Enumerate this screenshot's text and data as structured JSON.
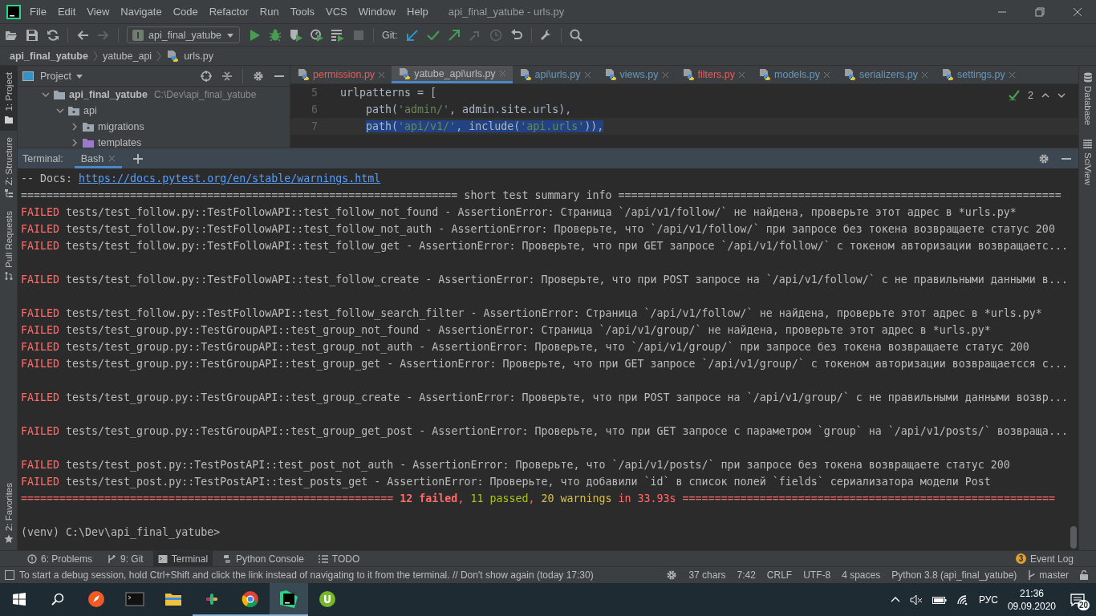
{
  "window": {
    "title": "api_final_yatube - urls.py"
  },
  "menu": [
    "File",
    "Edit",
    "View",
    "Navigate",
    "Code",
    "Refactor",
    "Run",
    "Tools",
    "VCS",
    "Window",
    "Help"
  ],
  "toolbar": {
    "run_config": "api_final_yatube",
    "git_label": "Git:"
  },
  "breadcrumb": [
    "api_final_yatube",
    "yatube_api",
    "urls.py"
  ],
  "left_tool_tabs": [
    {
      "label": "1: Project",
      "kind": "project",
      "selected": true
    },
    {
      "label": "Z: Structure",
      "kind": "structure",
      "selected": false
    },
    {
      "label": "Pull Requests",
      "kind": "pull_requests",
      "selected": false
    }
  ],
  "left_bottom_tabs": [
    {
      "label": "2: Favorites",
      "kind": "favorites",
      "selected": false
    }
  ],
  "right_tool_tabs": [
    {
      "label": "Database",
      "kind": "database"
    },
    {
      "label": "SciView",
      "kind": "sciview"
    }
  ],
  "project": {
    "title": "Project",
    "tree": [
      {
        "name": "api_final_yatube",
        "path": "C:\\Dev\\api_final_yatube",
        "kind": "root",
        "expanded": true,
        "children": [
          {
            "name": "api",
            "kind": "package",
            "expanded": true,
            "children": [
              {
                "name": "migrations",
                "kind": "package",
                "expanded": false
              },
              {
                "name": "templates",
                "kind": "templates",
                "expanded": false
              }
            ]
          }
        ]
      }
    ]
  },
  "editor_tabs": [
    {
      "label": "permission.py",
      "kind": "error",
      "selected": false
    },
    {
      "label": "yatube_api\\urls.py",
      "kind": "plain",
      "selected": true
    },
    {
      "label": "api\\urls.py",
      "kind": "modified",
      "selected": false
    },
    {
      "label": "views.py",
      "kind": "modified",
      "selected": false
    },
    {
      "label": "filters.py",
      "kind": "error",
      "selected": false
    },
    {
      "label": "models.py",
      "kind": "modified",
      "selected": false
    },
    {
      "label": "serializers.py",
      "kind": "modified",
      "selected": false
    },
    {
      "label": "settings.py",
      "kind": "modified",
      "selected": false
    }
  ],
  "editor": {
    "inspection_count": "2",
    "lines": [
      {
        "number": "5",
        "selected": false,
        "tokens": [
          {
            "text": "urlpatterns = [",
            "kind": "plain"
          }
        ]
      },
      {
        "number": "6",
        "selected": false,
        "tokens": [
          {
            "text": "    path(",
            "kind": "plain"
          },
          {
            "text": "'admin/'",
            "kind": "string"
          },
          {
            "text": ", admin.site.urls),",
            "kind": "plain"
          }
        ]
      },
      {
        "number": "7",
        "selected": true,
        "tokens": [
          {
            "text": "    path(",
            "kind": "plain"
          },
          {
            "text": "'api/v1/'",
            "kind": "string"
          },
          {
            "text": ", include(",
            "kind": "plain"
          },
          {
            "text": "'api.urls'",
            "kind": "string"
          },
          {
            "text": ")),",
            "kind": "plain"
          }
        ]
      }
    ]
  },
  "terminal": {
    "label": "Terminal:",
    "tabs": [
      {
        "label": "Bash",
        "selected": true
      }
    ],
    "lines": [
      {
        "kind": "docs",
        "prefix": "-- Docs: ",
        "link": "https://docs.pytest.org/en/stable/warnings.html"
      },
      {
        "kind": "rule",
        "text": "==================================================================== short test summary info ====================================================================="
      },
      {
        "kind": "failed",
        "status": "FAILED",
        "text": " tests/test_follow.py::TestFollowAPI::test_follow_not_found - AssertionError: Страница `/api/v1/follow/` не найдена, проверьте этот адрес в *urls.py*",
        "gap_after": false
      },
      {
        "kind": "failed",
        "status": "FAILED",
        "text": " tests/test_follow.py::TestFollowAPI::test_follow_not_auth - AssertionError: Проверьте, что `/api/v1/follow/` при запросе без токена возвращаете статус 200",
        "gap_after": false
      },
      {
        "kind": "failed",
        "status": "FAILED",
        "text": " tests/test_follow.py::TestFollowAPI::test_follow_get - AssertionError: Проверьте, что при GET запросе `/api/v1/follow/` с токеном авторизации возвращаетс...",
        "gap_after": true
      },
      {
        "kind": "failed",
        "status": "FAILED",
        "text": " tests/test_follow.py::TestFollowAPI::test_follow_create - AssertionError: Проверьте, что при POST запросе на `/api/v1/follow/` с не правильными данными в...",
        "gap_after": true
      },
      {
        "kind": "failed",
        "status": "FAILED",
        "text": " tests/test_follow.py::TestFollowAPI::test_follow_search_filter - AssertionError: Страница `/api/v1/follow/` не найдена, проверьте этот адрес в *urls.py*",
        "gap_after": false
      },
      {
        "kind": "failed",
        "status": "FAILED",
        "text": " tests/test_group.py::TestGroupAPI::test_group_not_found - AssertionError: Страница `/api/v1/group/` не найдена, проверьте этот адрес в *urls.py*",
        "gap_after": false
      },
      {
        "kind": "failed",
        "status": "FAILED",
        "text": " tests/test_group.py::TestGroupAPI::test_group_not_auth - AssertionError: Проверьте, что `/api/v1/group/` при запросе без токена возвращаете статус 200",
        "gap_after": false
      },
      {
        "kind": "failed",
        "status": "FAILED",
        "text": " tests/test_group.py::TestGroupAPI::test_group_get - AssertionError: Проверьте, что при GET запросе `/api/v1/group/` с токеном авторизации возвращаетсся с...",
        "gap_after": true
      },
      {
        "kind": "failed",
        "status": "FAILED",
        "text": " tests/test_group.py::TestGroupAPI::test_group_create - AssertionError: Проверьте, что при POST запросе на `/api/v1/group/` с не правильными данными возвр...",
        "gap_after": true
      },
      {
        "kind": "failed",
        "status": "FAILED",
        "text": " tests/test_group.py::TestGroupAPI::test_group_get_post - AssertionError: Проверьте, что при GET запросе с параметром `group` на `/api/v1/posts/` возвраща...",
        "gap_after": true
      },
      {
        "kind": "failed",
        "status": "FAILED",
        "text": " tests/test_post.py::TestPostAPI::test_post_not_auth - AssertionError: Проверьте, что `/api/v1/posts/` при запросе без токена возвращаете статус 200",
        "gap_after": false
      },
      {
        "kind": "failed",
        "status": "FAILED",
        "text": " tests/test_post.py::TestPostAPI::test_posts_get - AssertionError: Проверьте, что добавили `id` в список полей `fields` сериализатора модели Post",
        "gap_after": false
      },
      {
        "kind": "summary",
        "gap_after": true,
        "parts": [
          {
            "text": "========================================================== ",
            "kind": "plain"
          },
          {
            "text": "12 failed",
            "kind": "failed"
          },
          {
            "text": ", ",
            "kind": "plain"
          },
          {
            "text": "11 passed",
            "kind": "passed"
          },
          {
            "text": ", ",
            "kind": "plain"
          },
          {
            "text": "20 warnings",
            "kind": "warnings"
          },
          {
            "text": " in 33.93s ==========================================================",
            "kind": "plain"
          }
        ]
      },
      {
        "kind": "prompt",
        "text": "(venv) C:\\Dev\\api_final_yatube>"
      }
    ]
  },
  "tool_windows": [
    {
      "label": "6: Problems",
      "kind": "problems",
      "selected": false
    },
    {
      "label": "9: Git",
      "kind": "git",
      "selected": false
    },
    {
      "label": "Terminal",
      "kind": "terminal",
      "selected": true
    },
    {
      "label": "Python Console",
      "kind": "python",
      "selected": false
    },
    {
      "label": "TODO",
      "kind": "todo",
      "selected": false
    }
  ],
  "event_log": {
    "label": "Event Log",
    "count": "3"
  },
  "status_bar": {
    "message": "To start a debug session, hold Ctrl+Shift and click the link instead of navigating to it from the terminal. // Don't show again (today 17:30)",
    "items": [
      "37 chars",
      "7:42",
      "CRLF",
      "UTF-8",
      "4 spaces",
      "Python 3.8 (api_final_yatube)"
    ],
    "branch": "master"
  },
  "taskbar": {
    "apps": [
      {
        "kind": "rocket",
        "running": false,
        "selected": false
      },
      {
        "kind": "console",
        "running": false,
        "selected": false
      },
      {
        "kind": "explorer",
        "running": false,
        "selected": false
      },
      {
        "kind": "chat",
        "running": true,
        "selected": false
      },
      {
        "kind": "browser",
        "running": true,
        "selected": false
      },
      {
        "kind": "ide",
        "running": true,
        "selected": true
      },
      {
        "kind": "torrent",
        "running": false,
        "selected": false
      }
    ],
    "language": "РУС",
    "time": "21:36",
    "date": "09.09.2020",
    "notifications": "20"
  }
}
